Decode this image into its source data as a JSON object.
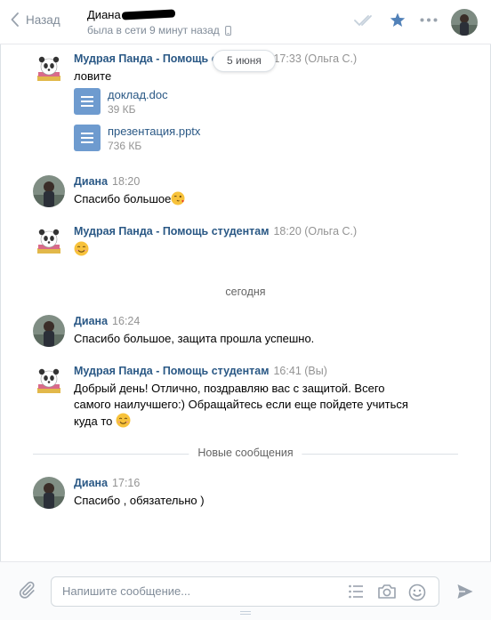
{
  "header": {
    "back_label": "Назад",
    "peer_name": "Диана",
    "peer_status": "была в сети 9 минут назад"
  },
  "messages": [
    {
      "author": "Мудрая Панда - Помощь студентам",
      "time": "17:33 (Ольга С.)",
      "text": "ловите",
      "docs": [
        {
          "name": "доклад.doc",
          "size": "39 КБ"
        },
        {
          "name": "презентация.pptx",
          "size": "736 КБ"
        }
      ]
    },
    {
      "author": "Диана",
      "time": "18:20",
      "text": "Спасибо большое"
    },
    {
      "author": "Мудрая Панда - Помощь студентам",
      "time": "18:20 (Ольга С.)",
      "text": ""
    },
    {
      "author": "Диана",
      "time": "16:24",
      "text": "Спасибо большое, защита прошла успешно."
    },
    {
      "author": "Мудрая Панда - Помощь студентам",
      "time": "16:41 (Вы)",
      "lines": [
        "Добрый день! Отлично, поздравляю вас с защитой. Всего",
        "самого наилучшего:) Обращайтесь если еще пойдете учиться",
        "куда то"
      ]
    },
    {
      "author": "Диана",
      "time": "17:16",
      "text": "Спасибо , обязательно )"
    }
  ],
  "date_pill": "5 июня",
  "separator_today": "сегодня",
  "separator_new": "Новые сообщения",
  "composer": {
    "placeholder": "Напишите сообщение..."
  },
  "icons": [
    "chevron-left-icon",
    "phone-icon",
    "read-checkmarks-icon",
    "star-icon",
    "more-icon",
    "document-icon",
    "wink-kiss-emoji",
    "smile-emoji",
    "paperclip-icon",
    "list-icon",
    "camera-icon",
    "emoji-icon",
    "send-icon"
  ],
  "colors": {
    "link": "#2a5885",
    "muted": "#818c99",
    "star": "#5181b8",
    "doc_icon": "#6e9bcf"
  }
}
